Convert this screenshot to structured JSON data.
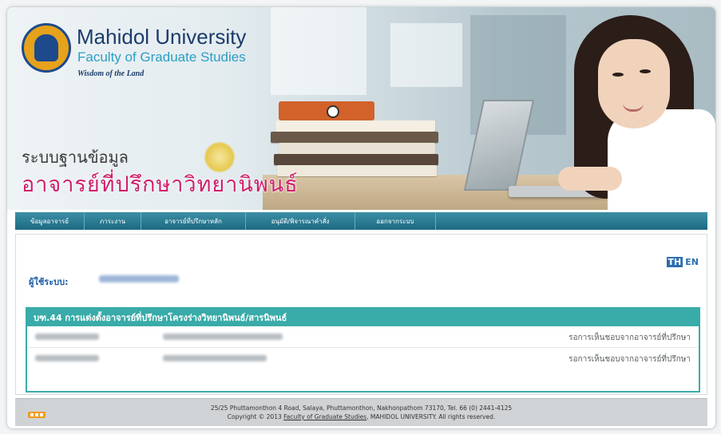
{
  "banner": {
    "university_name": "Mahidol University",
    "faculty": "Faculty of Graduate Studies",
    "motto": "Wisdom of the Land",
    "system_line1": "ระบบฐานข้อมูล",
    "system_line2": "อาจารย์ที่ปรึกษาวิทยานิพนธ์"
  },
  "nav": {
    "items": [
      {
        "label": "ข้อมูลอาจารย์"
      },
      {
        "label": "ภาระงาน"
      },
      {
        "label": "อาจารย์ที่ปรึกษาหลัก"
      },
      {
        "label": "อนุมัติ/พิจารณาคำสั่ง"
      },
      {
        "label": "ออกจากระบบ"
      }
    ]
  },
  "lang": {
    "th": "TH",
    "en": "EN"
  },
  "user": {
    "label": "ผู้ใช้ระบบ:"
  },
  "panel": {
    "title": "บฑ.44 การแต่งตั้งอาจารย์ที่ปรึกษาโครงร่างวิทยานิพนธ์/สารนิพนธ์",
    "rows": [
      {
        "status": "รอการเห็นชอบจากอาจารย์ที่ปรึกษา"
      },
      {
        "status": "รอการเห็นชอบจากอาจารย์ที่ปรึกษา"
      }
    ]
  },
  "footer": {
    "address": "25/25 Phuttamonthon 4 Road, Salaya, Phuttamonthon, Nakhonpathom 73170, Tel. 66 (0) 2441-4125",
    "copyright_prefix": "Copyright © 2013",
    "faculty_link": "Faculty of Graduate Studies",
    "copyright_suffix": ", MAHIDOL UNIVERSITY. All rights reserved."
  },
  "colors": {
    "nav": "#1c6a82",
    "panel_accent": "#39aba8",
    "title_pink": "#cf1f6b",
    "link_blue": "#1d5ea6"
  }
}
